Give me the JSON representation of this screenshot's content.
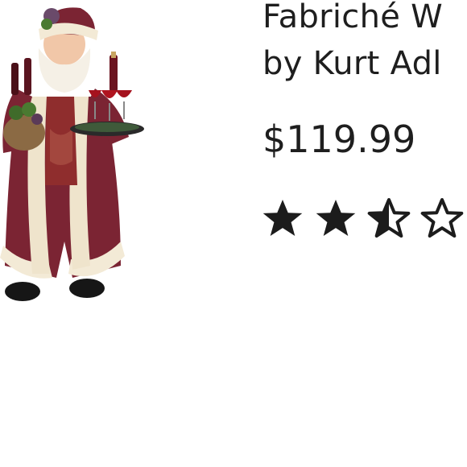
{
  "product": {
    "title_line1": "Fabriché W",
    "title_line2": "by Kurt Adl",
    "price": "$119.99",
    "rating": {
      "value": 2.5,
      "max": 5
    },
    "image_icon": "santa-figurine-image"
  },
  "colors": {
    "text": "#1e1e1e",
    "star": "#1c1c1c",
    "background": "#ffffff"
  }
}
